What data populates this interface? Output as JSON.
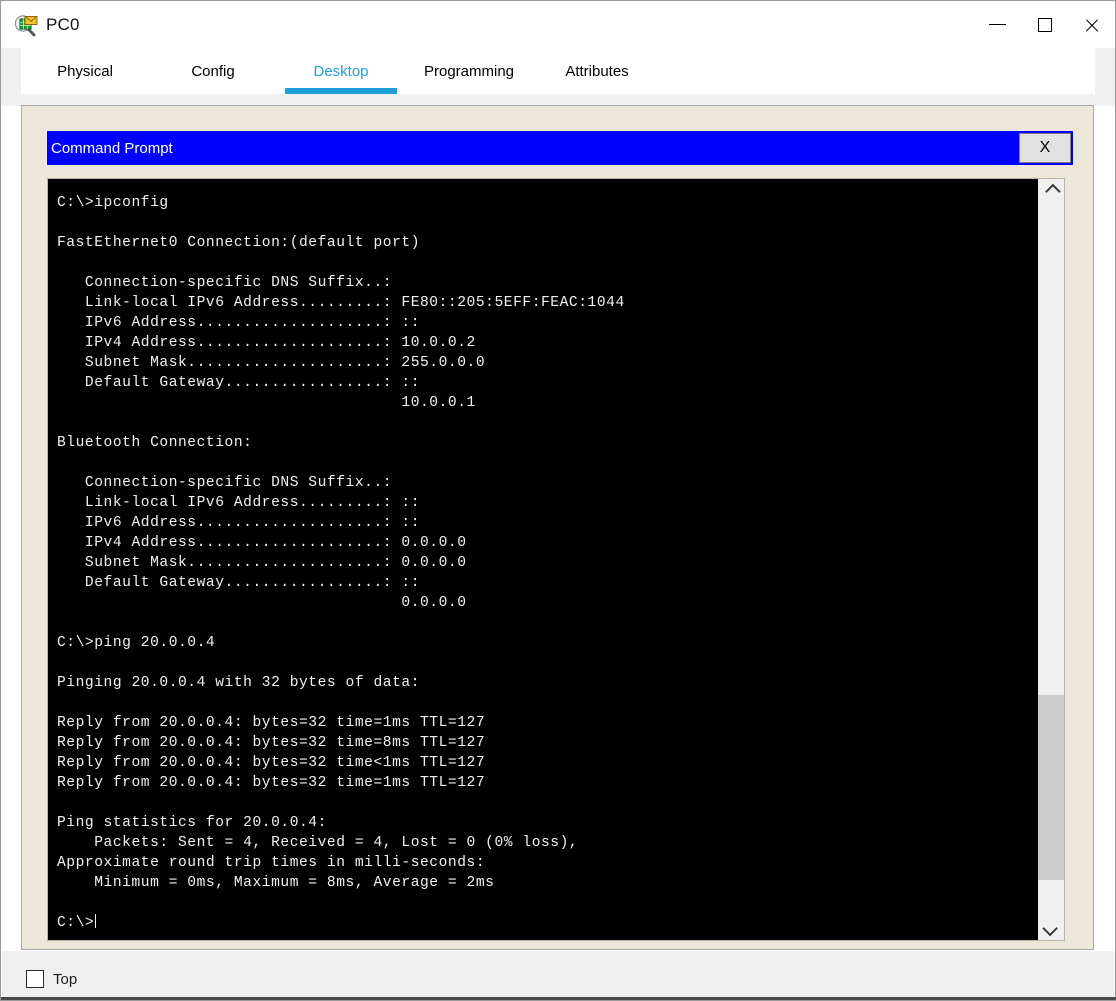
{
  "window": {
    "title": "PC0",
    "icon": "packet-tracer-inspect-icon",
    "controls": {
      "minimize_label": "Minimize",
      "maximize_label": "Maximize",
      "close_label": "Close"
    }
  },
  "tabs": [
    {
      "label": "Physical",
      "active": false
    },
    {
      "label": "Config",
      "active": false
    },
    {
      "label": "Desktop",
      "active": true
    },
    {
      "label": "Programming",
      "active": false
    },
    {
      "label": "Attributes",
      "active": false
    }
  ],
  "cmd_window": {
    "title": "Command Prompt",
    "close_label": "X"
  },
  "terminal": {
    "lines": [
      "C:\\>ipconfig",
      "",
      "FastEthernet0 Connection:(default port)",
      "",
      "   Connection-specific DNS Suffix..:",
      "   Link-local IPv6 Address.........: FE80::205:5EFF:FEAC:1044",
      "   IPv6 Address....................: ::",
      "   IPv4 Address....................: 10.0.0.2",
      "   Subnet Mask.....................: 255.0.0.0",
      "   Default Gateway.................: ::",
      "                                     10.0.0.1",
      "",
      "Bluetooth Connection:",
      "",
      "   Connection-specific DNS Suffix..:",
      "   Link-local IPv6 Address.........: ::",
      "   IPv6 Address....................: ::",
      "   IPv4 Address....................: 0.0.0.0",
      "   Subnet Mask.....................: 0.0.0.0",
      "   Default Gateway.................: ::",
      "                                     0.0.0.0",
      "",
      "C:\\>ping 20.0.0.4",
      "",
      "Pinging 20.0.0.4 with 32 bytes of data:",
      "",
      "Reply from 20.0.0.4: bytes=32 time=1ms TTL=127",
      "Reply from 20.0.0.4: bytes=32 time=8ms TTL=127",
      "Reply from 20.0.0.4: bytes=32 time<1ms TTL=127",
      "Reply from 20.0.0.4: bytes=32 time=1ms TTL=127",
      "",
      "Ping statistics for 20.0.0.4:",
      "    Packets: Sent = 4, Received = 4, Lost = 0 (0% loss),",
      "Approximate round trip times in milli-seconds:",
      "    Minimum = 0ms, Maximum = 8ms, Average = 2ms",
      "",
      "C:\\>"
    ],
    "prompt_cursor": true,
    "scrollbar": {
      "up_arrow": "chevron-up-icon",
      "down_arrow": "chevron-down-icon",
      "thumb_top_percent": 69,
      "thumb_height_percent": 26
    }
  },
  "bottom": {
    "top_checkbox_label": "Top",
    "top_checkbox_checked": false
  },
  "colors": {
    "accent_tab": "#1fa0d8",
    "cmd_titlebar": "#0000ff",
    "desktop_panel": "#ebe8da",
    "terminal_bg": "#000000",
    "terminal_fg": "#f2f2f2",
    "chrome_bg": "#f0f0f0"
  }
}
